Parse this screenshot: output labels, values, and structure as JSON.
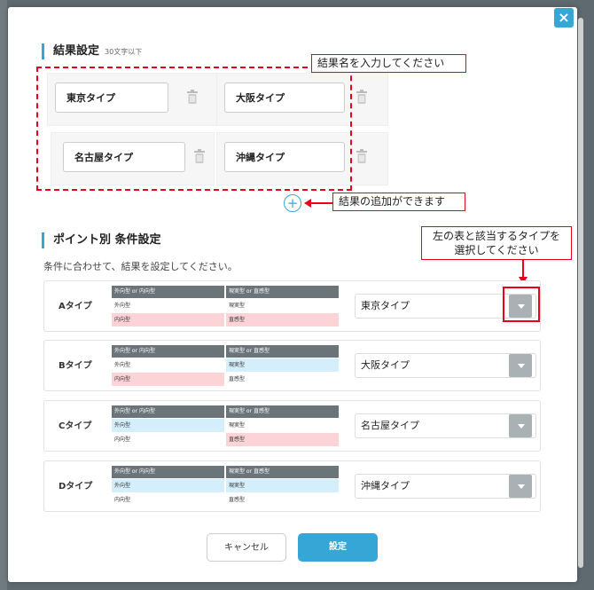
{
  "modal": {
    "close_label": "×",
    "result_section": {
      "title": "結果設定",
      "hint": "30文字以下",
      "results": [
        "東京タイプ",
        "大阪タイプ",
        "名古屋タイプ",
        "沖縄タイプ"
      ]
    },
    "condition_section": {
      "title": "ポイント別 条件設定",
      "description": "条件に合わせて、結果を設定してください。",
      "col_heads": [
        "外向型 or 内向型",
        "現実型 or 直感型"
      ],
      "rows": [
        {
          "label": "Aタイプ",
          "col1": [
            "外向型",
            "内向型"
          ],
          "col2": [
            "現実型",
            "直感型"
          ],
          "selected": "東京タイプ"
        },
        {
          "label": "Bタイプ",
          "col1": [
            "外向型",
            "内向型"
          ],
          "col2": [
            "現実型",
            "直感型"
          ],
          "selected": "大阪タイプ"
        },
        {
          "label": "Cタイプ",
          "col1": [
            "外向型",
            "内向型"
          ],
          "col2": [
            "現実型",
            "直感型"
          ],
          "selected": "名古屋タイプ"
        },
        {
          "label": "Dタイプ",
          "col1": [
            "外向型",
            "内向型"
          ],
          "col2": [
            "現実型",
            "直感型"
          ],
          "selected": "沖縄タイプ"
        }
      ]
    },
    "buttons": {
      "cancel": "キャンセル",
      "ok": "設定"
    },
    "plus_label": "+"
  },
  "annotations": {
    "input_names": "結果名を入力してください",
    "add_result": "結果の追加ができます",
    "select_type_line1": "左の表と該当するタイプを",
    "select_type_line2": "選択してください"
  },
  "colors": {
    "accent": "#36a6d6",
    "annotation": "#e8001c",
    "highlight_pink": "#fcd4d8",
    "highlight_blue": "#d5eefb"
  }
}
